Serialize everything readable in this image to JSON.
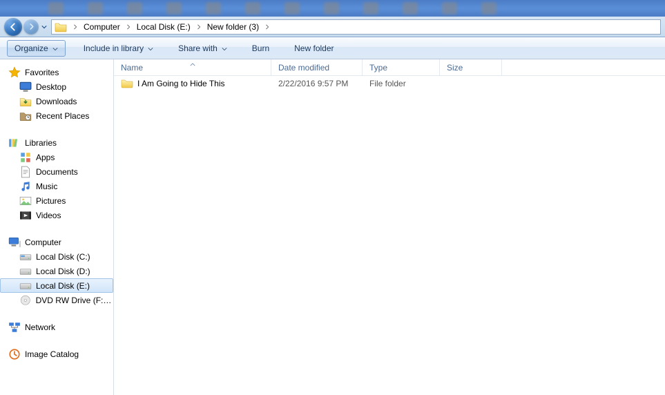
{
  "breadcrumb": [
    "Computer",
    "Local Disk (E:)",
    "New folder (3)"
  ],
  "toolbar": {
    "organize": "Organize",
    "include": "Include in library",
    "share": "Share with",
    "burn": "Burn",
    "newfolder": "New folder"
  },
  "columns": {
    "name": "Name",
    "date": "Date modified",
    "type": "Type",
    "size": "Size"
  },
  "items": [
    {
      "name": "I Am Going to Hide This",
      "date": "2/22/2016 9:57 PM",
      "type": "File folder",
      "size": ""
    }
  ],
  "sidebar": {
    "favorites": {
      "label": "Favorites",
      "items": [
        "Desktop",
        "Downloads",
        "Recent Places"
      ]
    },
    "libraries": {
      "label": "Libraries",
      "items": [
        "Apps",
        "Documents",
        "Music",
        "Pictures",
        "Videos"
      ]
    },
    "computer": {
      "label": "Computer",
      "items": [
        "Local Disk (C:)",
        "Local Disk (D:)",
        "Local Disk (E:)",
        "DVD RW Drive (F:)  M"
      ]
    },
    "network": {
      "label": "Network"
    },
    "imagecatalog": {
      "label": "Image Catalog"
    }
  },
  "selected_sidebar": "Local Disk (E:)"
}
